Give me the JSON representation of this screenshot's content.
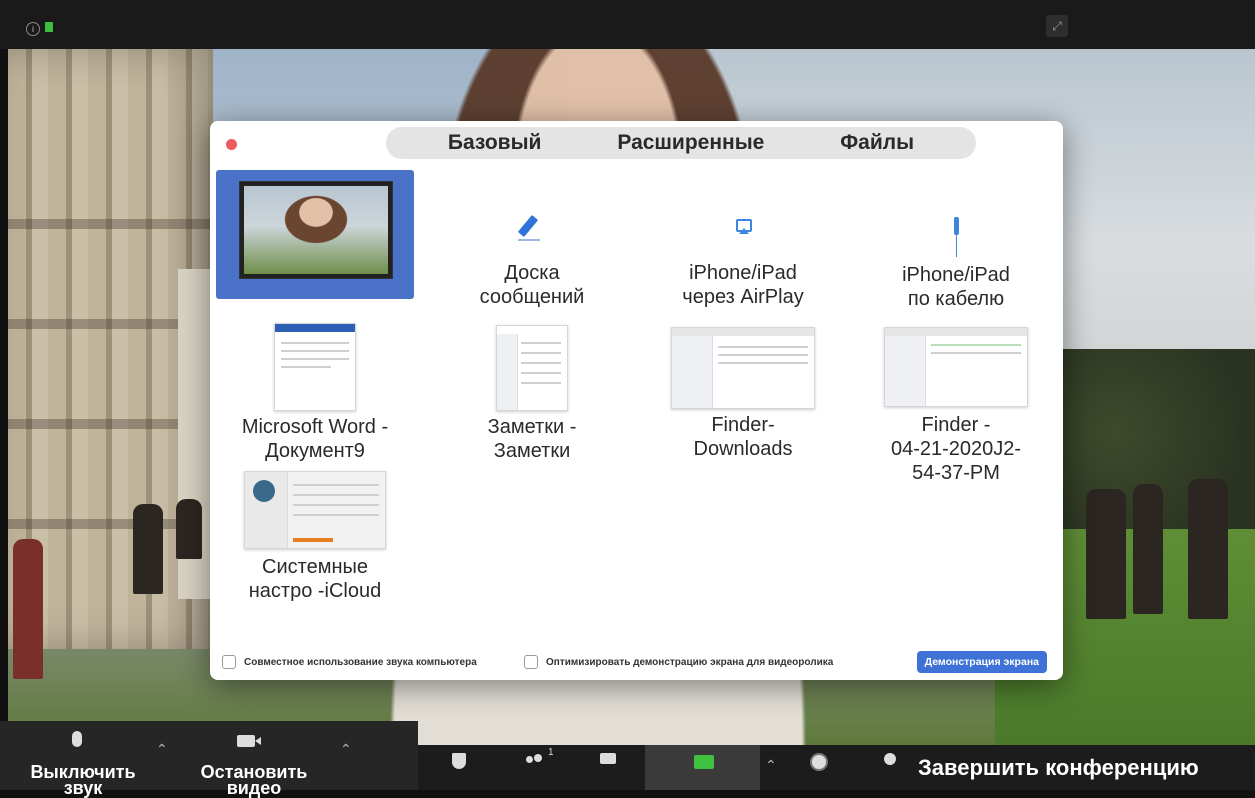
{
  "tabs": [
    "Базовый",
    "Расширенные",
    "Файлы"
  ],
  "tiles": {
    "whiteboard": [
      "Доска",
      "сообщений"
    ],
    "airplay": [
      "iPhone/iPad",
      "через AirPlay"
    ],
    "cable": [
      "iPhone/iPad",
      "по кабелю"
    ],
    "word": [
      "Microsoft Word -",
      "Документ9"
    ],
    "notes": [
      "Заметки -",
      "Заметки"
    ],
    "finder1": [
      "Finder-",
      "Downloads"
    ],
    "finder2": [
      "Finder -",
      "04-21-2020J2-",
      "54-37-PM"
    ],
    "settings": [
      "Системные",
      "настро -iCloud"
    ]
  },
  "options": {
    "share_audio": "Совместное использование звука компьютера",
    "optimize_video": "Оптимизировать демонстрацию экрана для видеоролика",
    "share_button": "Демонстрация экрана"
  },
  "toolbar": {
    "mute": [
      "Выключить",
      "звук"
    ],
    "video": [
      "Остановить",
      "видео"
    ],
    "participants_count": "1",
    "end": "Завершить конференцию"
  },
  "colors": {
    "accent": "#3e72d6",
    "selected_tile": "#4a72c8",
    "share_green": "#3fc23f",
    "close_red": "#ed5a5a"
  },
  "icons": {
    "top": [
      "info-icon",
      "lock-icon",
      "expand-icon"
    ],
    "toolbar": [
      "microphone-icon",
      "camera-icon",
      "security-icon",
      "participants-icon",
      "chat-icon",
      "share-screen-icon",
      "record-icon",
      "reactions-icon"
    ]
  }
}
